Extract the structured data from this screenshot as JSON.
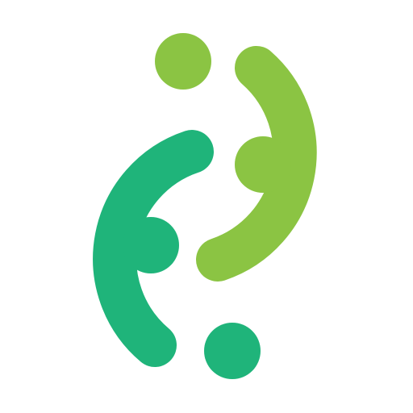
{
  "logo": {
    "name": "two-interlocking-arc-logo",
    "colors": {
      "background": "#ffffff",
      "dark_green": "#1fb47a",
      "light_green": "#8bc443"
    },
    "icons": [
      "left-dark-green-arc-icon",
      "right-light-green-arc-icon",
      "top-light-green-dot-icon",
      "center-light-green-dot-icon",
      "center-dark-green-dot-icon",
      "bottom-dark-green-dot-icon"
    ]
  }
}
